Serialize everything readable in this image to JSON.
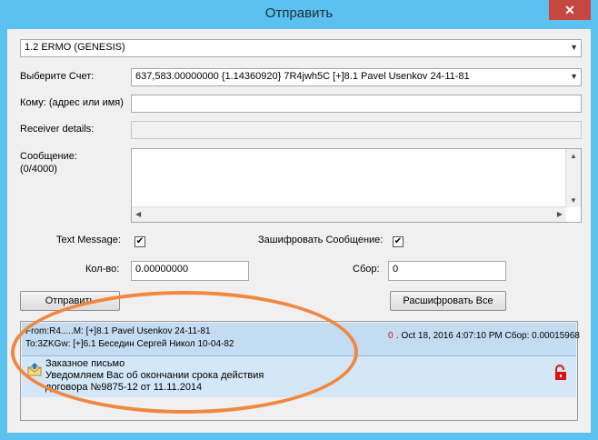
{
  "window": {
    "title": "Отправить",
    "close_glyph": "✕"
  },
  "network_select": {
    "value": "1.2 ERMO (GENESIS)"
  },
  "account": {
    "label": "Выберите Счет:",
    "value": "637,583.00000000 {1.14360920} 7R4jwh5C [+]8.1 Pavel Usenkov 24-11-81"
  },
  "to": {
    "label": "Кому: (адрес или имя)",
    "value": ""
  },
  "receiver": {
    "label": "Receiver details:",
    "value": ""
  },
  "message": {
    "label": "Сообщение:",
    "counter": "(0/4000)",
    "value": ""
  },
  "text_message": {
    "label": "Text Message:",
    "checked": "✔"
  },
  "encrypt": {
    "label": "Зашифровать Сообщение:",
    "checked": "✔"
  },
  "amount": {
    "label": "Кол-во:",
    "value": "0.00000000"
  },
  "fee": {
    "label": "Сбор:",
    "value": "0"
  },
  "buttons": {
    "send": "Отправить",
    "decrypt_all": "Расшифровать Все"
  },
  "message_item": {
    "from_line": "From:R4.....M: [+]8.1 Pavel Usenkov 24-11-81",
    "to_line": "To:3ZKGw: [+]6.1 Беседин Сергей Никол 10-04-82",
    "status_num": "0",
    "meta": ". Oct 18, 2016 4:07:10 PM Сбор: 0.00015968",
    "subject": "Заказное письмо",
    "body_line1": "Уведомляем Вас об окончании срока действия",
    "body_line2": "договора №9875-12 от 11.11.2014",
    "status_color": "#e01010"
  },
  "colors": {
    "titlebar": "#5bc2ef",
    "highlight_oval": "#f0883f",
    "lock": "#e01010"
  }
}
